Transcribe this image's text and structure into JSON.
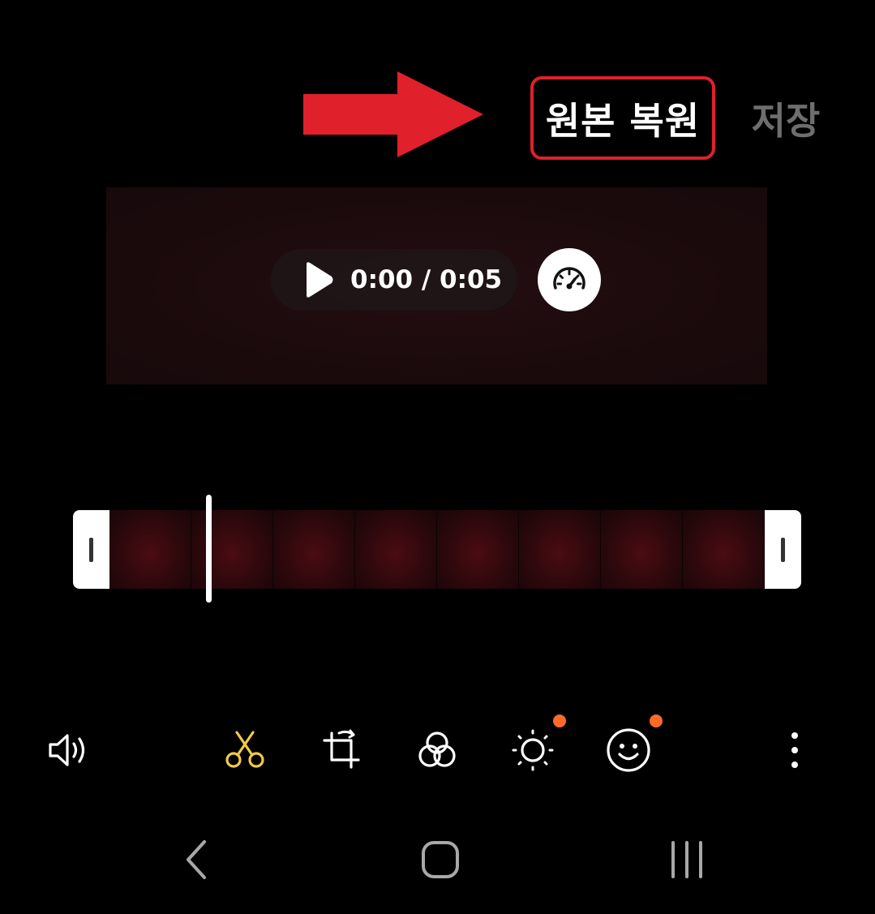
{
  "header": {
    "revert_label": "원본 복원",
    "save_label": "저장",
    "annotation_color": "#e0202a"
  },
  "player": {
    "time_display": "0:00 / 0:05",
    "play_icon": "play-icon",
    "speed_icon": "speedometer-icon"
  },
  "timeline": {
    "frame_count": 8,
    "playhead_progress": 0.15
  },
  "toolbar": {
    "items": [
      {
        "icon": "volume-icon",
        "active": false,
        "badge": false
      },
      {
        "icon": "scissors-icon",
        "active": true,
        "badge": false
      },
      {
        "icon": "crop-rotate-icon",
        "active": false,
        "badge": false
      },
      {
        "icon": "filter-circles-icon",
        "active": false,
        "badge": false
      },
      {
        "icon": "brightness-icon",
        "active": false,
        "badge": true
      },
      {
        "icon": "smiley-icon",
        "active": false,
        "badge": true
      },
      {
        "icon": "more-vertical-icon",
        "active": false,
        "badge": false
      }
    ],
    "active_color": "#f2c84b",
    "badge_color": "#ff6a2b"
  },
  "navbar": {
    "items": [
      "back-icon",
      "home-icon",
      "recents-icon"
    ]
  }
}
